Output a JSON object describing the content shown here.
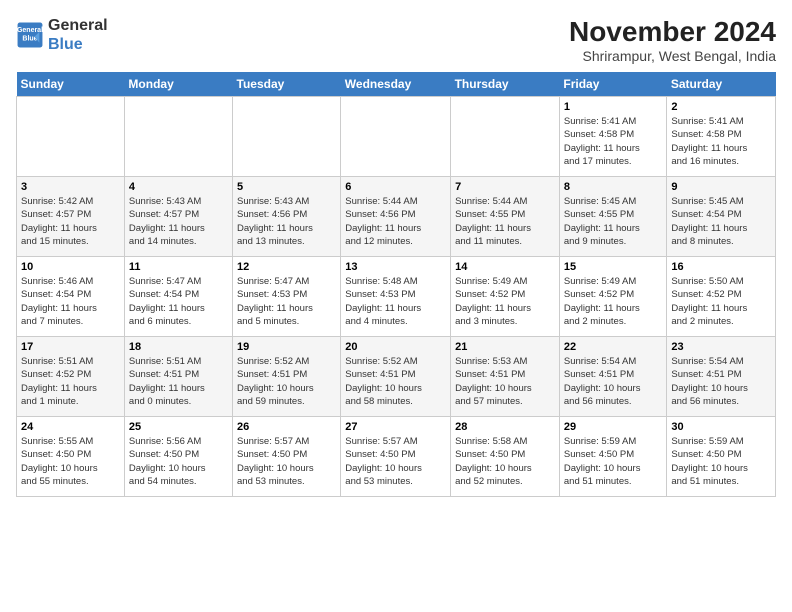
{
  "logo": {
    "line1": "General",
    "line2": "Blue"
  },
  "title": "November 2024",
  "location": "Shrirampur, West Bengal, India",
  "weekdays": [
    "Sunday",
    "Monday",
    "Tuesday",
    "Wednesday",
    "Thursday",
    "Friday",
    "Saturday"
  ],
  "weeks": [
    [
      {
        "day": "",
        "info": ""
      },
      {
        "day": "",
        "info": ""
      },
      {
        "day": "",
        "info": ""
      },
      {
        "day": "",
        "info": ""
      },
      {
        "day": "",
        "info": ""
      },
      {
        "day": "1",
        "info": "Sunrise: 5:41 AM\nSunset: 4:58 PM\nDaylight: 11 hours\nand 17 minutes."
      },
      {
        "day": "2",
        "info": "Sunrise: 5:41 AM\nSunset: 4:58 PM\nDaylight: 11 hours\nand 16 minutes."
      }
    ],
    [
      {
        "day": "3",
        "info": "Sunrise: 5:42 AM\nSunset: 4:57 PM\nDaylight: 11 hours\nand 15 minutes."
      },
      {
        "day": "4",
        "info": "Sunrise: 5:43 AM\nSunset: 4:57 PM\nDaylight: 11 hours\nand 14 minutes."
      },
      {
        "day": "5",
        "info": "Sunrise: 5:43 AM\nSunset: 4:56 PM\nDaylight: 11 hours\nand 13 minutes."
      },
      {
        "day": "6",
        "info": "Sunrise: 5:44 AM\nSunset: 4:56 PM\nDaylight: 11 hours\nand 12 minutes."
      },
      {
        "day": "7",
        "info": "Sunrise: 5:44 AM\nSunset: 4:55 PM\nDaylight: 11 hours\nand 11 minutes."
      },
      {
        "day": "8",
        "info": "Sunrise: 5:45 AM\nSunset: 4:55 PM\nDaylight: 11 hours\nand 9 minutes."
      },
      {
        "day": "9",
        "info": "Sunrise: 5:45 AM\nSunset: 4:54 PM\nDaylight: 11 hours\nand 8 minutes."
      }
    ],
    [
      {
        "day": "10",
        "info": "Sunrise: 5:46 AM\nSunset: 4:54 PM\nDaylight: 11 hours\nand 7 minutes."
      },
      {
        "day": "11",
        "info": "Sunrise: 5:47 AM\nSunset: 4:54 PM\nDaylight: 11 hours\nand 6 minutes."
      },
      {
        "day": "12",
        "info": "Sunrise: 5:47 AM\nSunset: 4:53 PM\nDaylight: 11 hours\nand 5 minutes."
      },
      {
        "day": "13",
        "info": "Sunrise: 5:48 AM\nSunset: 4:53 PM\nDaylight: 11 hours\nand 4 minutes."
      },
      {
        "day": "14",
        "info": "Sunrise: 5:49 AM\nSunset: 4:52 PM\nDaylight: 11 hours\nand 3 minutes."
      },
      {
        "day": "15",
        "info": "Sunrise: 5:49 AM\nSunset: 4:52 PM\nDaylight: 11 hours\nand 2 minutes."
      },
      {
        "day": "16",
        "info": "Sunrise: 5:50 AM\nSunset: 4:52 PM\nDaylight: 11 hours\nand 2 minutes."
      }
    ],
    [
      {
        "day": "17",
        "info": "Sunrise: 5:51 AM\nSunset: 4:52 PM\nDaylight: 11 hours\nand 1 minute."
      },
      {
        "day": "18",
        "info": "Sunrise: 5:51 AM\nSunset: 4:51 PM\nDaylight: 11 hours\nand 0 minutes."
      },
      {
        "day": "19",
        "info": "Sunrise: 5:52 AM\nSunset: 4:51 PM\nDaylight: 10 hours\nand 59 minutes."
      },
      {
        "day": "20",
        "info": "Sunrise: 5:52 AM\nSunset: 4:51 PM\nDaylight: 10 hours\nand 58 minutes."
      },
      {
        "day": "21",
        "info": "Sunrise: 5:53 AM\nSunset: 4:51 PM\nDaylight: 10 hours\nand 57 minutes."
      },
      {
        "day": "22",
        "info": "Sunrise: 5:54 AM\nSunset: 4:51 PM\nDaylight: 10 hours\nand 56 minutes."
      },
      {
        "day": "23",
        "info": "Sunrise: 5:54 AM\nSunset: 4:51 PM\nDaylight: 10 hours\nand 56 minutes."
      }
    ],
    [
      {
        "day": "24",
        "info": "Sunrise: 5:55 AM\nSunset: 4:50 PM\nDaylight: 10 hours\nand 55 minutes."
      },
      {
        "day": "25",
        "info": "Sunrise: 5:56 AM\nSunset: 4:50 PM\nDaylight: 10 hours\nand 54 minutes."
      },
      {
        "day": "26",
        "info": "Sunrise: 5:57 AM\nSunset: 4:50 PM\nDaylight: 10 hours\nand 53 minutes."
      },
      {
        "day": "27",
        "info": "Sunrise: 5:57 AM\nSunset: 4:50 PM\nDaylight: 10 hours\nand 53 minutes."
      },
      {
        "day": "28",
        "info": "Sunrise: 5:58 AM\nSunset: 4:50 PM\nDaylight: 10 hours\nand 52 minutes."
      },
      {
        "day": "29",
        "info": "Sunrise: 5:59 AM\nSunset: 4:50 PM\nDaylight: 10 hours\nand 51 minutes."
      },
      {
        "day": "30",
        "info": "Sunrise: 5:59 AM\nSunset: 4:50 PM\nDaylight: 10 hours\nand 51 minutes."
      }
    ]
  ]
}
